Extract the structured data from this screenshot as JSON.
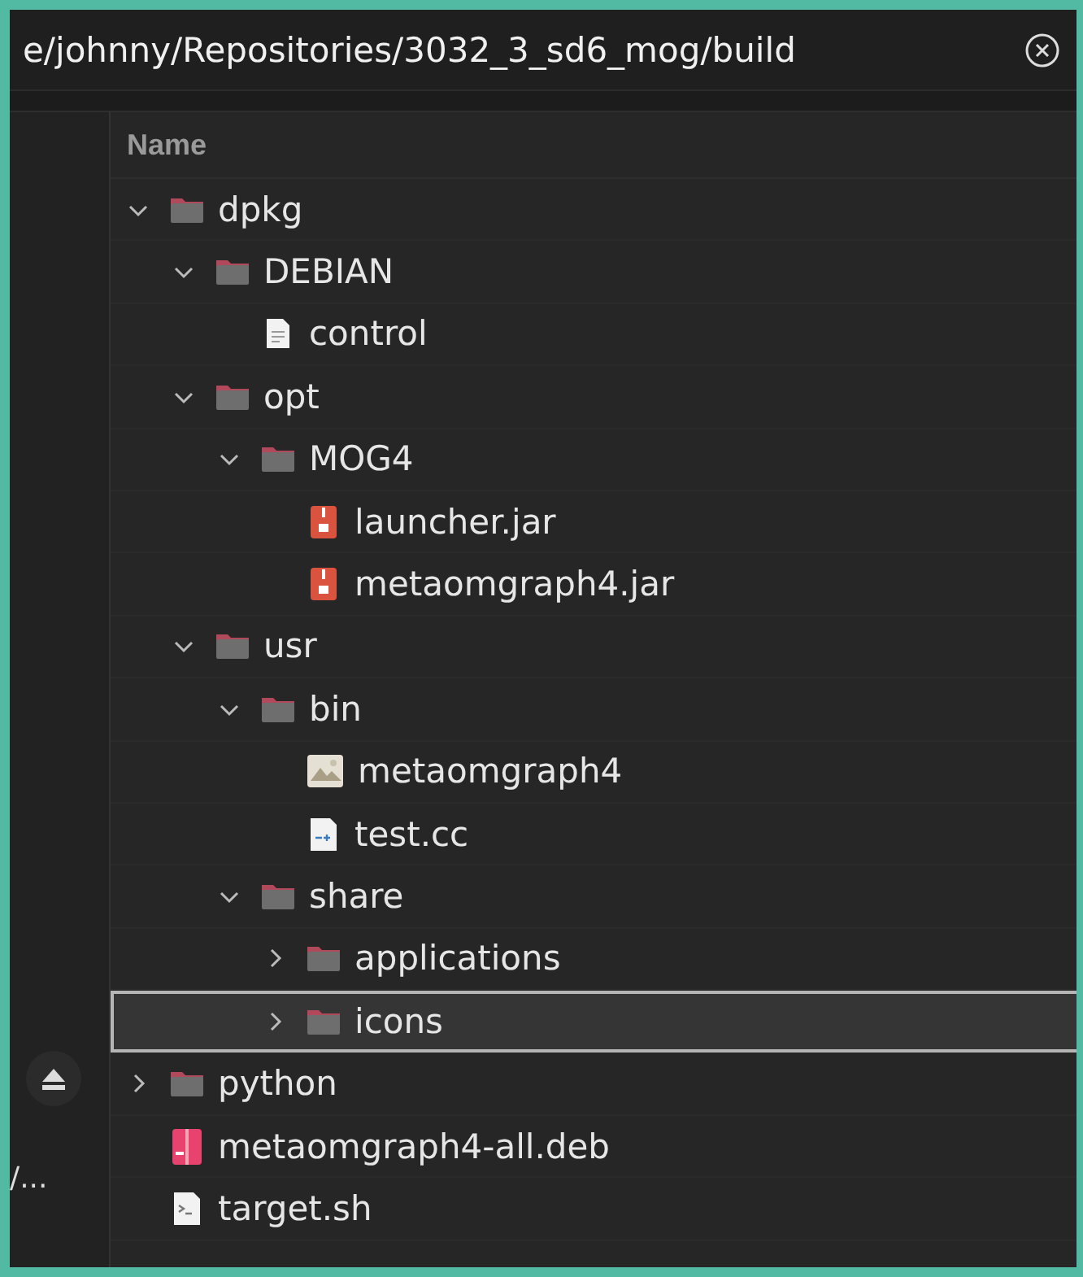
{
  "window": {
    "title": "e/johnny/Repositories/3032_3_sd6_mog/build"
  },
  "sidebar": {
    "items": [
      {
        "kind": "eject"
      },
      {
        "kind": "label",
        "label": "/..."
      }
    ]
  },
  "table": {
    "columns": [
      "Name"
    ],
    "tree": [
      {
        "name": "dpkg",
        "kind": "folder",
        "expanded": true,
        "selected": false,
        "children": [
          {
            "name": "DEBIAN",
            "kind": "folder",
            "expanded": true,
            "selected": false,
            "children": [
              {
                "name": "control",
                "kind": "text",
                "selected": false
              }
            ]
          },
          {
            "name": "opt",
            "kind": "folder",
            "expanded": true,
            "selected": false,
            "children": [
              {
                "name": "MOG4",
                "kind": "folder",
                "expanded": true,
                "selected": false,
                "children": [
                  {
                    "name": "launcher.jar",
                    "kind": "jar",
                    "selected": false
                  },
                  {
                    "name": "metaomgraph4.jar",
                    "kind": "jar",
                    "selected": false
                  }
                ]
              }
            ]
          },
          {
            "name": "usr",
            "kind": "folder",
            "expanded": true,
            "selected": false,
            "children": [
              {
                "name": "bin",
                "kind": "folder",
                "expanded": true,
                "selected": false,
                "children": [
                  {
                    "name": "metaomgraph4",
                    "kind": "image",
                    "selected": false
                  },
                  {
                    "name": "test.cc",
                    "kind": "cpp",
                    "selected": false
                  }
                ]
              },
              {
                "name": "share",
                "kind": "folder",
                "expanded": true,
                "selected": false,
                "children": [
                  {
                    "name": "applications",
                    "kind": "folder",
                    "expanded": false,
                    "selected": false
                  },
                  {
                    "name": "icons",
                    "kind": "folder",
                    "expanded": false,
                    "selected": true
                  }
                ]
              }
            ]
          }
        ]
      },
      {
        "name": "python",
        "kind": "folder",
        "expanded": false,
        "selected": false
      },
      {
        "name": "metaomgraph4-all.deb",
        "kind": "deb",
        "selected": false
      },
      {
        "name": "target.sh",
        "kind": "script",
        "selected": false
      }
    ]
  }
}
